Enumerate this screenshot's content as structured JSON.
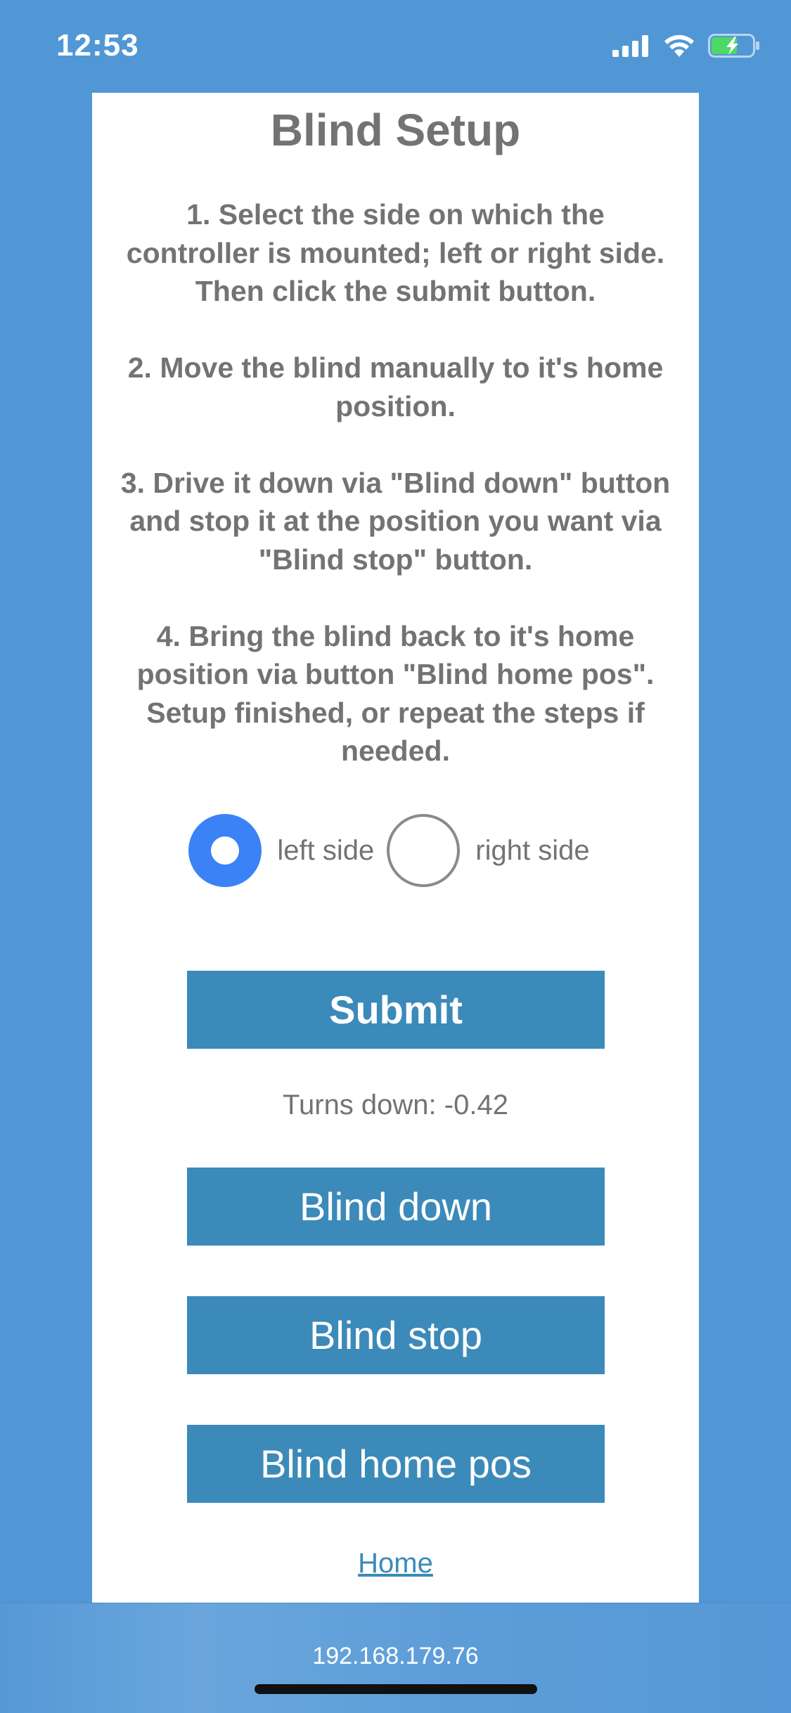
{
  "status_bar": {
    "time": "12:53"
  },
  "page": {
    "title": "Blind Setup",
    "instructions": [
      "1. Select the side on which the controller is mounted; left or right side. Then click the submit button.",
      "2. Move the blind manually to it's home position.",
      "3. Drive it down via \"Blind down\" button and stop it at the position you want via \"Blind stop\" button.",
      "4. Bring the blind back to it's home position via button \"Blind home pos\". Setup finished, or repeat the steps if needed."
    ],
    "mount_side": {
      "options": [
        "left side",
        "right side"
      ],
      "selected": "left side"
    },
    "submit_label": "Submit",
    "turns_down": "Turns down: -0.42",
    "blind_down_label": "Blind down",
    "blind_stop_label": "Blind stop",
    "blind_home_label": "Blind home pos",
    "home_link": "Home"
  },
  "browser": {
    "url": "192.168.179.76"
  },
  "colors": {
    "background": "#5197d6",
    "button": "#3b8ab9",
    "radio_selected": "#3b82f6",
    "text": "#737373",
    "battery_fill": "#4cd964"
  },
  "icons": [
    "cellular-signal-icon",
    "wifi-icon",
    "battery-charging-icon"
  ]
}
